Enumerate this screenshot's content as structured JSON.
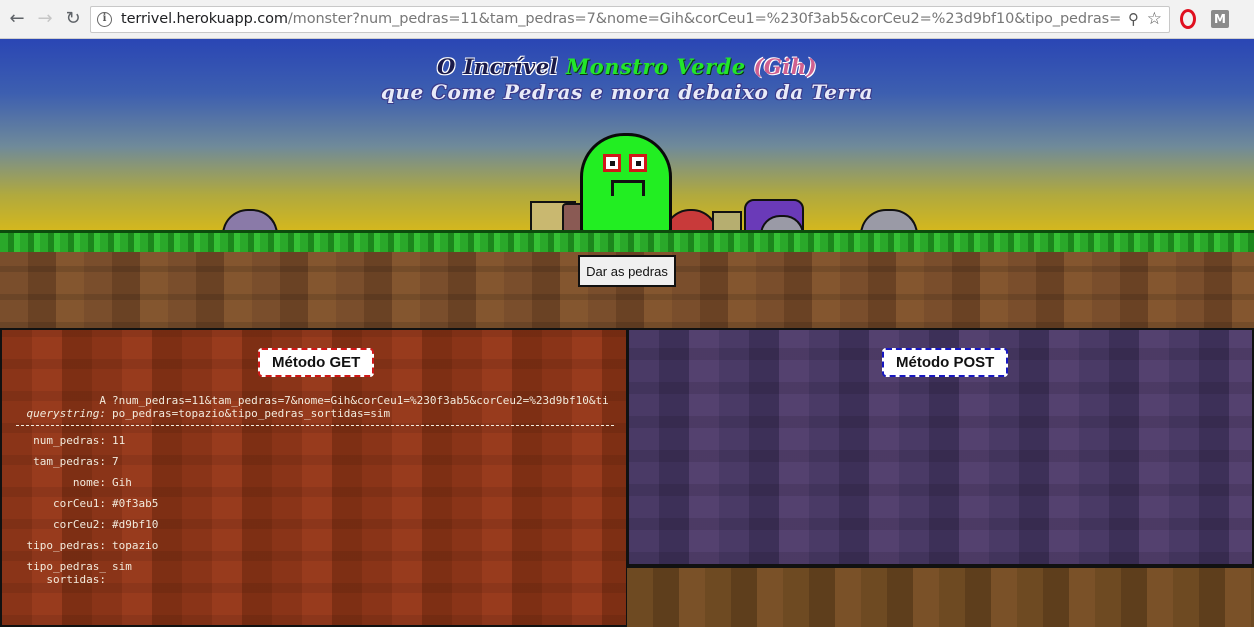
{
  "browser": {
    "url_host": "terrivel.herokuapp.com",
    "url_rest": "/monster?num_pedras=11&tam_pedras=7&nome=Gih&corCeu1=%230f3ab5&corCeu2=%23d9bf10&tipo_pedras=topazio&tipo_pedras_",
    "ext2_label": "M"
  },
  "header": {
    "title_part1": "O Incrível",
    "title_part2": "Monstro Verde",
    "title_part3": "(Gih)",
    "subtitle": "que Come Pedras e mora debaixo da Terra"
  },
  "feed_button": "Dar as pedras",
  "get_panel": {
    "title": "Método GET",
    "qs_key_prefix": "A",
    "qs_key_word": "querystring:",
    "qs_value": "?num_pedras=11&tam_pedras=7&nome=Gih&corCeu1=%230f3ab5&corCeu2=%23d9bf10&tipo_pedras=topazio&tipo_pedras_sortidas=sim",
    "params": [
      {
        "key": "num_pedras:",
        "value": "11"
      },
      {
        "key": "tam_pedras:",
        "value": "7"
      },
      {
        "key": "nome:",
        "value": "Gih"
      },
      {
        "key": "corCeu1:",
        "value": "#0f3ab5"
      },
      {
        "key": "corCeu2:",
        "value": "#d9bf10"
      },
      {
        "key": "tipo_pedras:",
        "value": "topazio"
      },
      {
        "key": "tipo_pedras_ sortidas:",
        "value": "sim"
      }
    ]
  },
  "post_panel": {
    "title": "Método POST"
  },
  "colors": {
    "sky_top": "#0f3ab5",
    "sky_bottom": "#d9bf10",
    "monster": "#22ee22"
  },
  "icons": [
    "back-icon",
    "forward-icon",
    "reload-icon",
    "info-icon",
    "zoom-icon",
    "star-icon",
    "opera-icon",
    "extension-icon"
  ]
}
